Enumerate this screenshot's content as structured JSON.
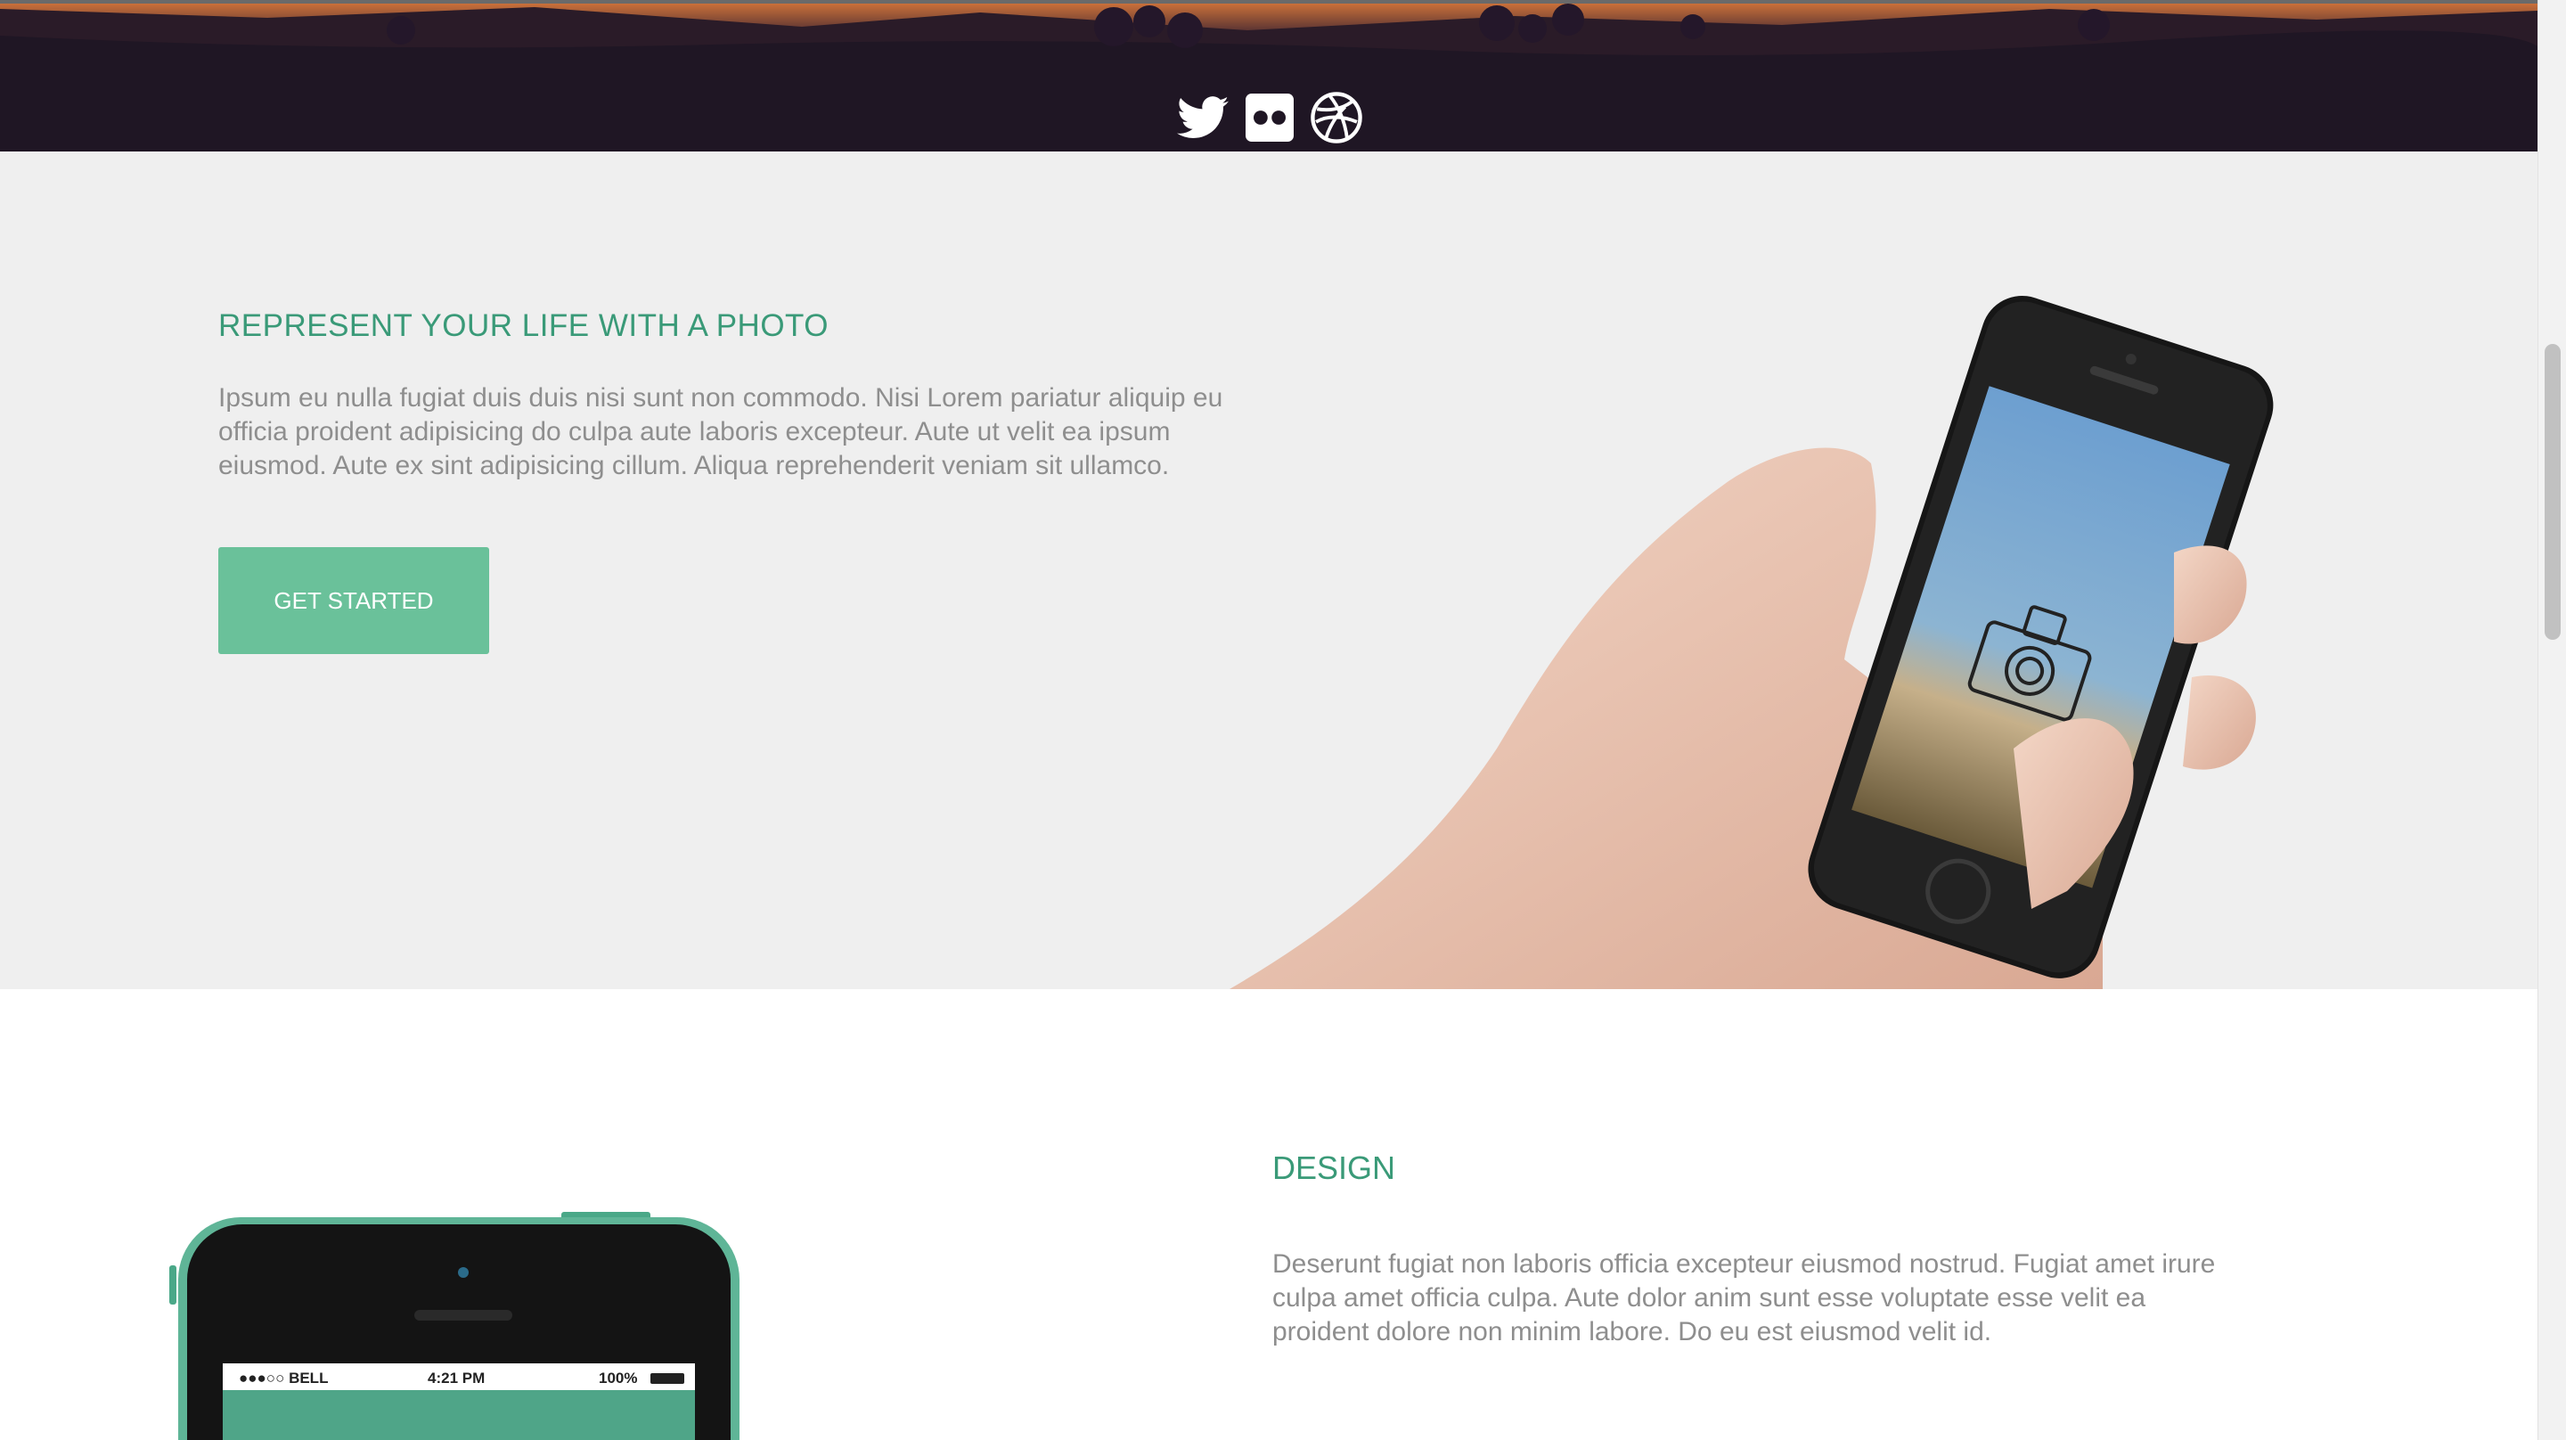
{
  "hero": {
    "social_icons": [
      "twitter-icon",
      "flickr-icon",
      "dribbble-icon"
    ]
  },
  "feature": {
    "heading": "REPRESENT YOUR LIFE WITH A PHOTO",
    "body": "Ipsum eu nulla fugiat duis duis nisi sunt non commodo. Nisi Lorem pariatur aliquip eu officia proident adipisicing do culpa aute laboris excepteur. Aute ut velit ea ipsum eiusmod. Aute ex sint adipisicing cillum. Aliqua reprehenderit veniam sit ullamco.",
    "button_label": "GET STARTED"
  },
  "design": {
    "heading": "DESIGN",
    "body": "Deserunt fugiat non laboris officia excepteur eiusmod nostrud. Fugiat amet irure culpa amet officia culpa. Aute dolor anim sunt esse voluptate esse velit ea proident dolore non minim labore. Do eu est eiusmod velit id.",
    "phone_status": {
      "carrier": "●●●○○ BELL",
      "time": "4:21 PM",
      "battery": "100%"
    }
  },
  "colors": {
    "accent": "#3a9a78",
    "button": "#6ac19a",
    "hero_bg": "#1f1624",
    "section_bg": "#efefef",
    "body_text": "#8e8e8e"
  }
}
